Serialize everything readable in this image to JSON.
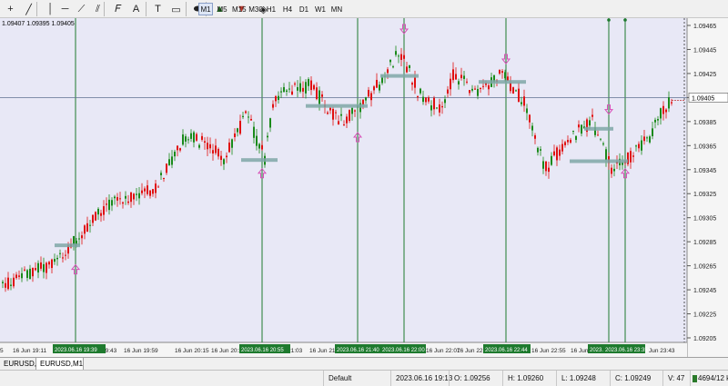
{
  "toolbar": {
    "icons": [
      "crosshair-icon",
      "line-icon",
      "vertical-line-icon",
      "horizontal-line-icon",
      "trendline-icon",
      "channel-icon",
      "fibonacci-icon",
      "text-icon",
      "text-label-icon",
      "rectangle-icon",
      "ellipse-icon",
      "arrow-up-icon",
      "arrow-down-icon",
      "shapes-icon"
    ],
    "timeframes": [
      "M1",
      "M5",
      "M15",
      "M30",
      "H1",
      "H4",
      "D1",
      "W1",
      "MN"
    ],
    "active_timeframe": "M1"
  },
  "chart": {
    "ohlc_text": "1.09407 1.09395 1.09405",
    "background": "#e8e8f6",
    "up_color": "#1a8a1a",
    "down_color": "#e01010",
    "current_price_label": "1.09405",
    "price_ticks": [
      "1.09465",
      "1.09445",
      "1.09425",
      "1.09405",
      "1.09385",
      "1.09365",
      "1.09345",
      "1.09325",
      "1.09305",
      "1.09285",
      "1.09265",
      "1.09245",
      "1.09225",
      "1.09205"
    ],
    "time_labels": [
      "5",
      "16 Jun 19:11",
      "19:43",
      "16 Jun 19:59",
      "16 Jun 20:15",
      "16 Jun 20:31",
      "21:03",
      "16 Jun 21:19",
      "16 Jun 22:07",
      "16 Jun 22:23",
      "16 Jun 22:55",
      "16 Jun 23:11",
      "Jun 23:43"
    ],
    "highlight_labels": [
      "2023.06.16 19:39",
      "2023.06.16 20:55",
      "2023.06.16 21:40",
      "2023.06.16 22:00",
      "2023.06.16 22:44",
      "2023.",
      "2023.06.16 23:35"
    ]
  },
  "tabs": [
    "EURUSD,M1",
    "EURUSD,M1"
  ],
  "status": {
    "profile": "Default",
    "datetime": "2023.06.16 19:13",
    "open": "O: 1.09256",
    "high": "H: 1.09260",
    "low": "L: 1.09248",
    "close": "C: 1.09249",
    "volume": "V: 47",
    "traffic": "4694/12 kb"
  }
}
